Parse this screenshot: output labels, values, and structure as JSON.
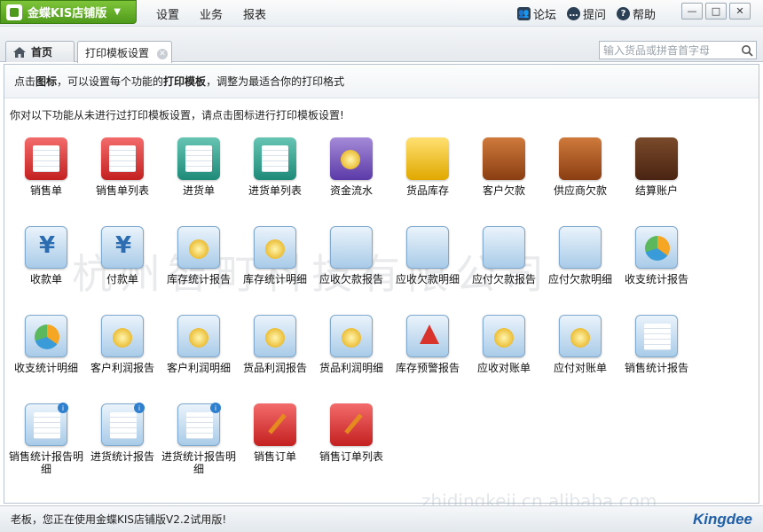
{
  "app": {
    "title": "金蝶KIS店铺版",
    "menu": [
      "设置",
      "业务",
      "报表"
    ],
    "top_links": [
      {
        "icon": "people-icon",
        "label": "论坛"
      },
      {
        "icon": "chat-icon",
        "label": "提问"
      },
      {
        "icon": "help-icon",
        "label": "帮助"
      }
    ]
  },
  "tabs": {
    "home": "首页",
    "active": "打印模板设置"
  },
  "search": {
    "placeholder": "输入货品或拼音首字母"
  },
  "info": {
    "prefix": "点击",
    "bold1": "图标",
    "middle": "，可以设置每个功能的",
    "bold2": "打印模板",
    "suffix": "，调整为最适合你的打印格式"
  },
  "note": "你对以下功能从未进行过打印模板设置，请点击图标进行打印模板设置!",
  "watermark": "杭州智町科技有限公司",
  "watermark_url": "zhidingkeji.cn.alibaba.com",
  "items": [
    {
      "label": "销售单",
      "icon": "sales-order-icon"
    },
    {
      "label": "销售单列表",
      "icon": "sales-order-list-icon"
    },
    {
      "label": "进货单",
      "icon": "purchase-order-icon"
    },
    {
      "label": "进货单列表",
      "icon": "purchase-order-list-icon"
    },
    {
      "label": "资金流水",
      "icon": "cash-flow-icon"
    },
    {
      "label": "货品库存",
      "icon": "inventory-icon"
    },
    {
      "label": "客户欠款",
      "icon": "customer-debt-icon"
    },
    {
      "label": "供应商欠款",
      "icon": "supplier-debt-icon"
    },
    {
      "label": "结算账户",
      "icon": "settlement-account-icon"
    },
    {
      "label": "收款单",
      "icon": "receipt-icon"
    },
    {
      "label": "付款单",
      "icon": "payment-icon"
    },
    {
      "label": "库存统计报告",
      "icon": "inventory-report-icon"
    },
    {
      "label": "库存统计明细",
      "icon": "inventory-detail-icon"
    },
    {
      "label": "应收欠款报告",
      "icon": "receivable-report-icon"
    },
    {
      "label": "应收欠款明细",
      "icon": "receivable-detail-icon"
    },
    {
      "label": "应付欠款报告",
      "icon": "payable-report-icon"
    },
    {
      "label": "应付欠款明细",
      "icon": "payable-detail-icon"
    },
    {
      "label": "收支统计报告",
      "icon": "income-report-icon"
    },
    {
      "label": "收支统计明细",
      "icon": "income-detail-icon"
    },
    {
      "label": "客户利润报告",
      "icon": "customer-profit-report-icon"
    },
    {
      "label": "客户利润明细",
      "icon": "customer-profit-detail-icon"
    },
    {
      "label": "货品利润报告",
      "icon": "goods-profit-report-icon"
    },
    {
      "label": "货品利润明细",
      "icon": "goods-profit-detail-icon"
    },
    {
      "label": "库存预警报告",
      "icon": "stock-warning-icon"
    },
    {
      "label": "应收对账单",
      "icon": "receivable-statement-icon"
    },
    {
      "label": "应付对账单",
      "icon": "payable-statement-icon"
    },
    {
      "label": "销售统计报告",
      "icon": "sales-report-icon"
    },
    {
      "label": "销售统计报告明细",
      "icon": "sales-report-detail-icon"
    },
    {
      "label": "进货统计报告",
      "icon": "purchase-report-icon"
    },
    {
      "label": "进货统计报告明细",
      "icon": "purchase-report-detail-icon"
    },
    {
      "label": "销售订单",
      "icon": "sales-orders-icon"
    },
    {
      "label": "销售订单列表",
      "icon": "sales-orders-list-icon"
    }
  ],
  "status": "老板，您正在使用金蝶KIS店铺版V2.2试用版!",
  "brand": "Kingdee"
}
